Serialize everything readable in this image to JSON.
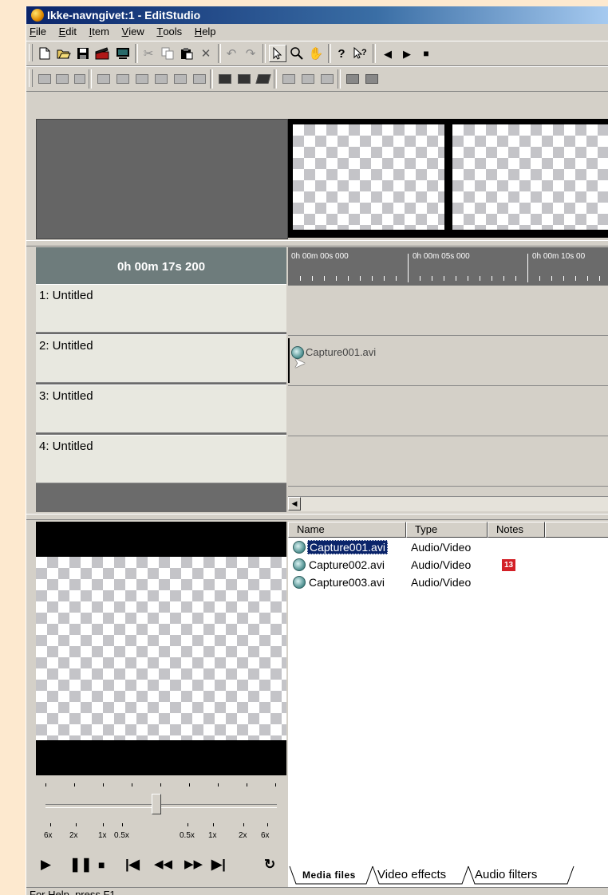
{
  "window": {
    "title": "Ikke-navngivet:1 - EditStudio"
  },
  "menu": [
    {
      "label": "File",
      "u": "F",
      "rest": "ile"
    },
    {
      "label": "Edit",
      "u": "E",
      "rest": "dit"
    },
    {
      "label": "Item",
      "u": "I",
      "rest": "tem"
    },
    {
      "label": "View",
      "u": "V",
      "rest": "iew"
    },
    {
      "label": "Tools",
      "u": "T",
      "rest": "ools"
    },
    {
      "label": "Help",
      "u": "H",
      "rest": "elp"
    }
  ],
  "timeline": {
    "current_time": "0h 00m 17s 200",
    "tracks": [
      "1: Untitled",
      "2: Untitled",
      "3: Untitled",
      "4: Untitled"
    ],
    "ruler": [
      "0h 00m 00s 000",
      "0h 00m 05s 000",
      "0h 00m 10s 00"
    ],
    "clip": {
      "name": "Capture001.avi",
      "track": 2
    }
  },
  "playback": {
    "speed_labels": [
      "6x",
      "2x",
      "1x",
      "0.5x",
      "0.5x",
      "1x",
      "2x",
      "6x"
    ],
    "speed_value": 0.5
  },
  "media_list": {
    "columns": [
      "Name",
      "Type",
      "Notes"
    ],
    "rows": [
      {
        "name": "Capture001.avi",
        "type": "Audio/Video",
        "note": "",
        "selected": true
      },
      {
        "name": "Capture002.avi",
        "type": "Audio/Video",
        "note": "13",
        "selected": false
      },
      {
        "name": "Capture003.avi",
        "type": "Audio/Video",
        "note": "",
        "selected": false
      }
    ]
  },
  "tabs": [
    "Media files",
    "Video effects",
    "Audio filters"
  ],
  "status": "For Help, press F1",
  "colors": {
    "title_bar": "#0a246a",
    "badge": "#d32027",
    "selection": "#0a246a"
  }
}
